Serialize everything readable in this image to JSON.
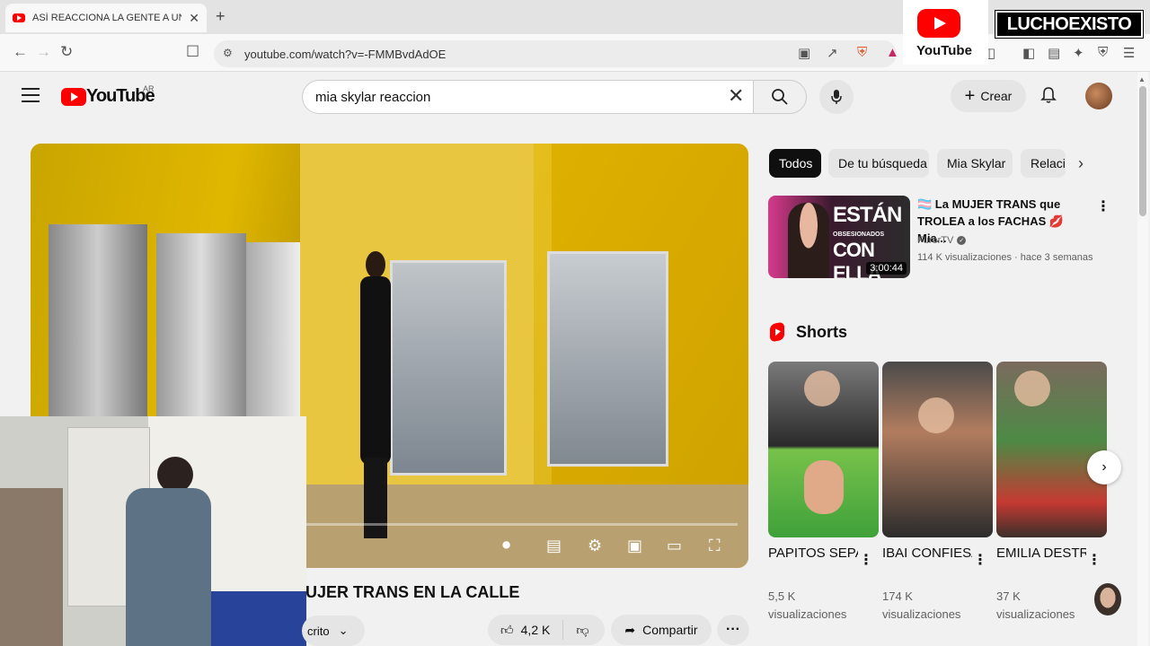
{
  "browser": {
    "tab_title": "ASÍ REACCIONA LA GENTE A UNA",
    "tab_close": "✕",
    "new_tab": "+",
    "url": "youtube.com/watch?v=-FMMBvdAdOE"
  },
  "overlay": {
    "youtube_label": "YouTube",
    "channel_tag": "LUCHOEXISTO"
  },
  "header": {
    "logo_text": "YouTube",
    "country": "AR",
    "search_value": "mia skylar reaccion",
    "create_label": "Crear"
  },
  "video": {
    "title": "UJER TRANS EN LA CALLE",
    "subscribe_label": "crito",
    "likes": "4,2 K",
    "share_label": "Compartir"
  },
  "sidebar": {
    "chips": [
      {
        "label": "Todos"
      },
      {
        "label": "De tu búsqueda"
      },
      {
        "label": "Mia Skylar"
      },
      {
        "label": "Relaci"
      }
    ],
    "recommended": {
      "title": "🏳️‍⚧️ La MUJER TRANS que TROLEA a los FACHAS 💋 Mia...",
      "thumb_line1": "ESTÁN",
      "thumb_line2": "OBSESIONADOS",
      "thumb_line3": "CON ELLA",
      "duration": "3:00:44",
      "channel": "FurorTV",
      "meta": "114 K visualizaciones · hace 3 semanas"
    },
    "shorts_label": "Shorts",
    "shorts": [
      {
        "title": "PAPITOS SEPARADO...",
        "views": "5,5 K visualizaciones"
      },
      {
        "title": "IBAI CONFIESA ...",
        "views": "174 K visualizaciones"
      },
      {
        "title": "EMILIA DESTROZÓ...",
        "views": "37 K visualizaciones"
      }
    ]
  },
  "icons": {
    "tab_favicon": "youtube-favicon",
    "back": "←",
    "forward": "→",
    "reload": "↻",
    "bookmark": "bookmark-icon",
    "menu": "hamburger-icon",
    "search": "search-icon",
    "mic": "mic-icon",
    "bell": "bell-icon"
  }
}
